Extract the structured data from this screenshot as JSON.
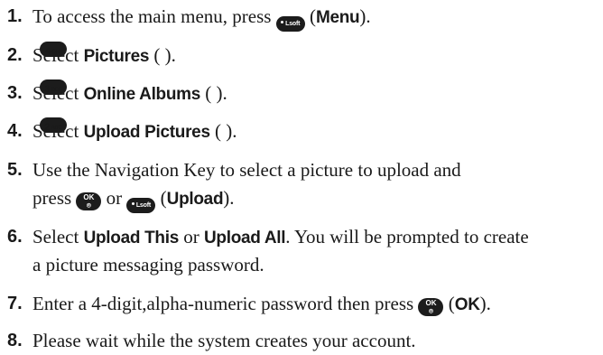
{
  "keys": {
    "menu_soft": "Lsoft",
    "ok": "OK",
    "ok_symbol": "⌾",
    "num4": "4",
    "num4_letters": "GHI",
    "num3": "3",
    "num3_letters": "DEF",
    "num2": "2",
    "num2_letters": "ABC"
  },
  "steps": [
    {
      "num": "1.",
      "pre": "To access the main menu, press ",
      "open": " (",
      "bold": "Menu",
      "close": ")."
    },
    {
      "num": "2.",
      "pre": "Select ",
      "bold": "Pictures",
      "open": " ( ",
      "close": " )."
    },
    {
      "num": "3.",
      "pre": "Select ",
      "bold": "Online Albums",
      "open": " ( ",
      "close": " )."
    },
    {
      "num": "4.",
      "pre": "Select ",
      "bold": "Upload Pictures",
      "open": " ( ",
      "close": " )."
    },
    {
      "num": "5.",
      "line1": "Use the Navigation Key to select a picture to upload and",
      "pre2": "press ",
      "mid": " or ",
      "open": " (",
      "bold": "Upload",
      "close": ")."
    },
    {
      "num": "6.",
      "pre": "Select ",
      "bold1": "Upload This",
      "mid": " or ",
      "bold2": "Upload All",
      "post": ". You will be prompted to create",
      "line2": "a picture messaging password."
    },
    {
      "num": "7.",
      "pre": "Enter a 4-digit,alpha-numeric password then press ",
      "open": " (",
      "bold": "OK",
      "close": ")."
    },
    {
      "num": "8.",
      "text": "Please wait while the system creates your account."
    }
  ]
}
